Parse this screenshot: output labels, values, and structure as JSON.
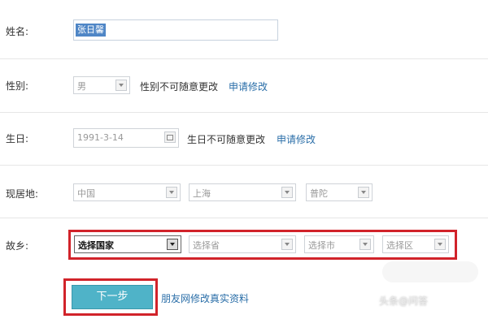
{
  "form": {
    "name": {
      "label": "姓名:",
      "value": "张日馨"
    },
    "gender": {
      "label": "性别:",
      "value": "男",
      "note": "性别不可随意更改",
      "link": "申请修改"
    },
    "birthday": {
      "label": "生日:",
      "value": "1991-3-14",
      "note": "生日不可随意更改",
      "link": "申请修改"
    },
    "residence": {
      "label": "现居地:",
      "country": "中国",
      "province": "上海",
      "district": "普陀"
    },
    "hometown": {
      "label": "故乡:",
      "country_placeholder": "选择国家",
      "province_placeholder": "选择省",
      "city_placeholder": "选择市",
      "district_placeholder": "选择区"
    },
    "next_button": "下一步",
    "friend_link": "朋友网修改真实资料"
  },
  "watermark": "头条@问答",
  "colors": {
    "accent": "#4fb3c8",
    "link": "#2a6ea8",
    "highlight": "#d1232a"
  }
}
